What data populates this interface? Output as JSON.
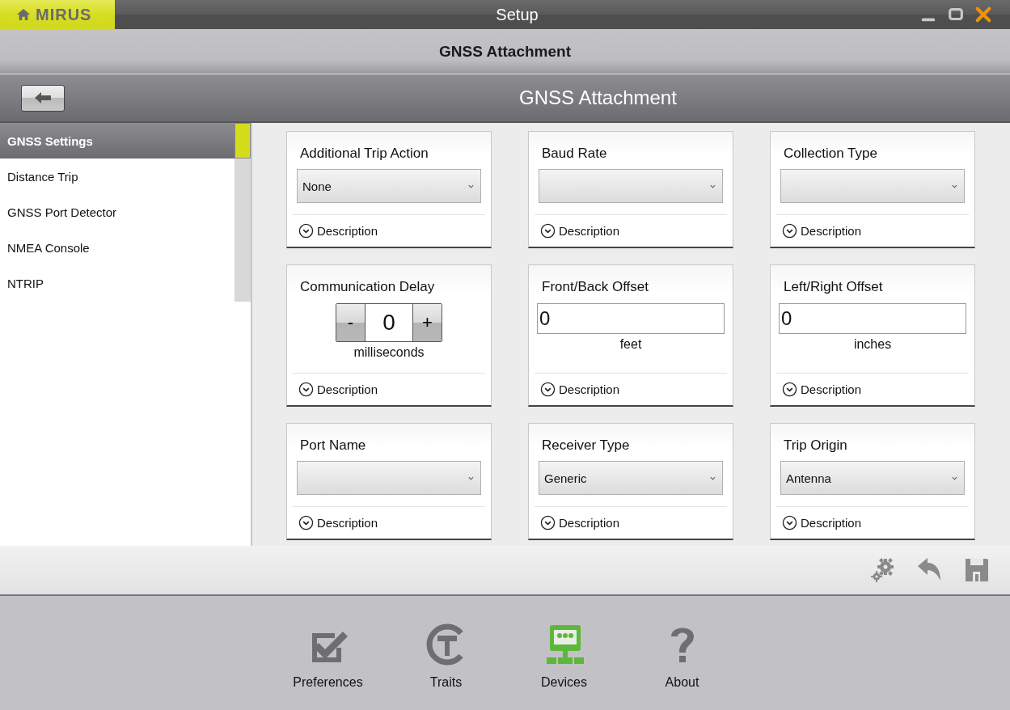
{
  "window": {
    "logo": "MIRUS",
    "title": "Setup"
  },
  "header": {
    "title": "GNSS Attachment"
  },
  "subheader": {
    "title": "GNSS Attachment"
  },
  "sidebar": {
    "items": [
      {
        "label": "GNSS Settings",
        "selected": true
      },
      {
        "label": "Distance Trip",
        "selected": false
      },
      {
        "label": "GNSS Port Detector",
        "selected": false
      },
      {
        "label": "NMEA Console",
        "selected": false
      },
      {
        "label": "NTRIP",
        "selected": false
      }
    ]
  },
  "settings": [
    {
      "kind": "dropdown",
      "title": "Additional Trip Action",
      "value": "None",
      "description": "Description"
    },
    {
      "kind": "dropdown",
      "title": "Baud Rate",
      "description": "Description"
    },
    {
      "kind": "dropdown",
      "title": "Collection Type",
      "description": "Description"
    },
    {
      "kind": "stepper",
      "title": "Communication Delay",
      "minus": "-",
      "value": "0",
      "plus": "+",
      "unit": "milliseconds",
      "description": "Description"
    },
    {
      "kind": "number",
      "title": "Front/Back Offset",
      "value": "0",
      "unit": "feet",
      "description": "Description"
    },
    {
      "kind": "number",
      "title": "Left/Right Offset",
      "value": "0",
      "unit": "inches",
      "description": "Description"
    },
    {
      "kind": "dropdown",
      "title": "Port Name",
      "description": "Description"
    },
    {
      "kind": "dropdown",
      "title": "Receiver Type",
      "value": "Generic",
      "description": "Description"
    },
    {
      "kind": "dropdown",
      "title": "Trip Origin",
      "value": "Antenna",
      "description": "Description"
    }
  ],
  "nav": [
    {
      "kind": "preferences",
      "label": "Preferences",
      "selected": false
    },
    {
      "kind": "traits",
      "label": "Traits",
      "selected": false
    },
    {
      "kind": "devices",
      "label": "Devices",
      "selected": true
    },
    {
      "kind": "about",
      "label": "About",
      "selected": false
    }
  ]
}
